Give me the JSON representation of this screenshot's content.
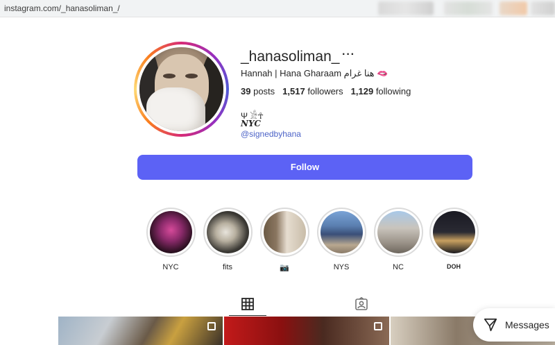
{
  "browser": {
    "url": "instagram.com/_hanasoliman_/"
  },
  "profile": {
    "username": "_hanasoliman_",
    "more_label": "···",
    "full_name": "Hannah | Hana Gharaam هنا غرام 🫦",
    "stats": {
      "posts": "39",
      "posts_label": "posts",
      "followers": "1,517",
      "followers_label": "followers",
      "following": "1,129",
      "following_label": "following"
    },
    "bio_line1": "Ψ 𓀀☥",
    "bio_line2": "NYC",
    "link": "@signedbyhana"
  },
  "follow_button": {
    "label": "Follow",
    "color": "#5c62f5"
  },
  "highlights": [
    {
      "label": "NYC"
    },
    {
      "label": "fits"
    },
    {
      "label": "📷"
    },
    {
      "label": "NYS"
    },
    {
      "label": "NC"
    },
    {
      "label": "DOH"
    }
  ],
  "tabs": [
    {
      "name": "posts",
      "icon": "grid-icon",
      "active": true
    },
    {
      "name": "tagged",
      "icon": "tagged-icon",
      "active": false
    }
  ],
  "messages": {
    "label": "Messages",
    "icon": "send-icon"
  }
}
